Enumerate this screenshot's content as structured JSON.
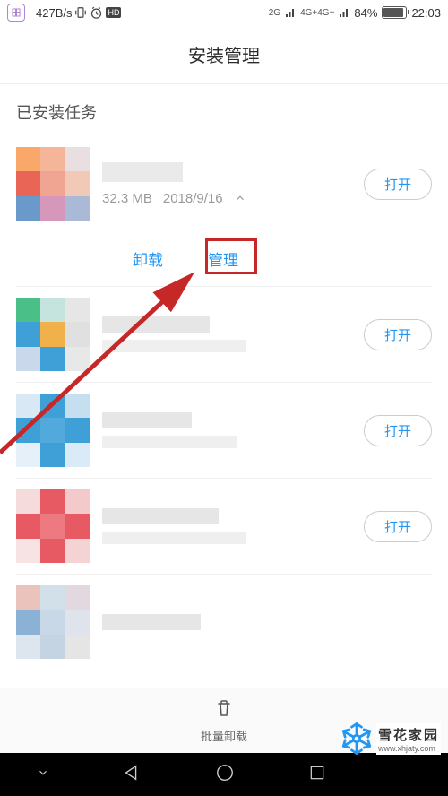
{
  "status_bar": {
    "net_speed": "427B/s",
    "signal_2g": "2G",
    "signal_4g": "4G+4G+",
    "battery_pct": "84%",
    "time": "22:03"
  },
  "title": "安装管理",
  "section": "已安装任务",
  "apps": [
    {
      "size": "32.3 MB",
      "date": "2018/9/16",
      "open_label": "打开",
      "expanded": true
    },
    {
      "open_label": "打开"
    },
    {
      "open_label": "打开"
    },
    {
      "open_label": "打开"
    }
  ],
  "actions": {
    "uninstall": "卸载",
    "manage": "管理"
  },
  "bottom": {
    "batch_label": "批量卸载"
  },
  "watermark": {
    "name": "雪花家园",
    "url": "www.xhjaty.com"
  }
}
